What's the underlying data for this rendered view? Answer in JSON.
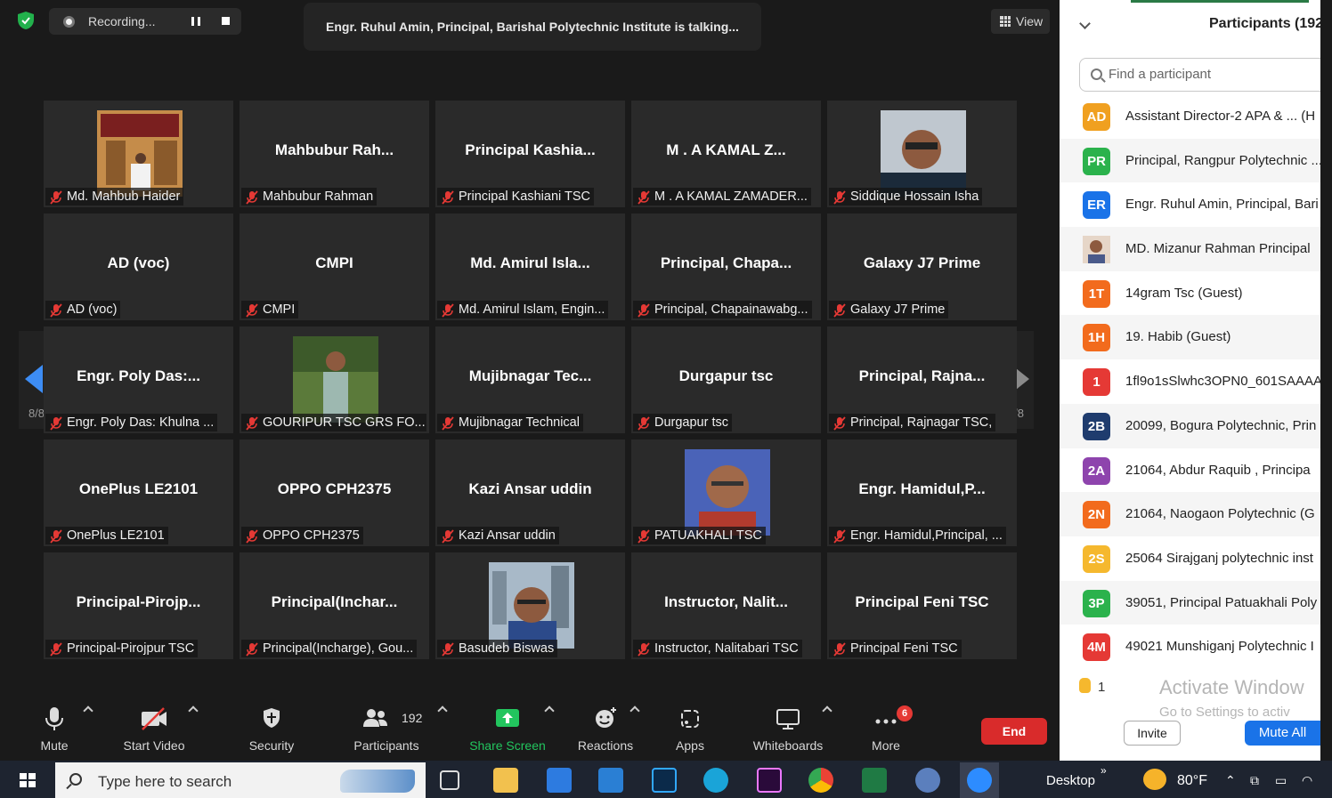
{
  "recording": {
    "label": "Recording..."
  },
  "talking_banner": "Engr. Ruhul Amin, Principal, Barishal Polytechnic Institute is talking...",
  "view_button": "View",
  "page_indicator": "8/8",
  "tiles": [
    {
      "title": "",
      "label": "Md. Mahbub Haider",
      "photo": "office-room"
    },
    {
      "title": "Mahbubur  Rah...",
      "label": "Mahbubur Rahman"
    },
    {
      "title": "Principal  Kashia...",
      "label": "Principal Kashiani TSC"
    },
    {
      "title": "M . A KAMAL Z...",
      "label": "M . A KAMAL ZAMADER..."
    },
    {
      "title": "",
      "label": "Siddique Hossain Isha",
      "photo": "man-glasses"
    },
    {
      "title": "AD (voc)",
      "label": "AD (voc)"
    },
    {
      "title": "CMPI",
      "label": "CMPI"
    },
    {
      "title": "Md. Amirul Isla...",
      "label": "Md. Amirul Islam, Engin..."
    },
    {
      "title": "Principal,  Chapa...",
      "label": "Principal, Chapainawabg..."
    },
    {
      "title": "Galaxy J7 Prime",
      "label": "Galaxy J7 Prime"
    },
    {
      "title": "Engr. Poly  Das:...",
      "label": "Engr. Poly  Das: Khulna ..."
    },
    {
      "title": "",
      "label": "GOURIPUR TSC GRS FO...",
      "photo": "man-outdoor"
    },
    {
      "title": "Mujibnagar  Tec...",
      "label": "Mujibnagar Technical"
    },
    {
      "title": "Durgapur tsc",
      "label": "Durgapur tsc"
    },
    {
      "title": "Principal,  Rajna...",
      "label": "Principal, Rajnagar TSC,"
    },
    {
      "title": "OnePlus LE2101",
      "label": "OnePlus LE2101"
    },
    {
      "title": "OPPO CPH2375",
      "label": "OPPO CPH2375"
    },
    {
      "title": "Kazi Ansar uddin",
      "label": "Kazi Ansar uddin"
    },
    {
      "title": "",
      "label": "PATUAKHALI TSC",
      "photo": "man-portrait"
    },
    {
      "title": "Engr.  Hamidul,P...",
      "label": "Engr. Hamidul,Principal, ..."
    },
    {
      "title": "Principal-Pirojp...",
      "label": "Principal-Pirojpur TSC"
    },
    {
      "title": "Principal(Inchar...",
      "label": "Principal(Incharge), Gou..."
    },
    {
      "title": "",
      "label": "Basudeb Biswas",
      "photo": "man-city"
    },
    {
      "title": "Instructor,  Nalit...",
      "label": "Instructor,  Nalitabari TSC"
    },
    {
      "title": "Principal Feni TSC",
      "label": "Principal Feni TSC"
    }
  ],
  "toolbar": {
    "mute": "Mute",
    "start_video": "Start Video",
    "security": "Security",
    "participants": "Participants",
    "participant_count": "192",
    "share_screen": "Share Screen",
    "reactions": "Reactions",
    "apps": "Apps",
    "whiteboards": "Whiteboards",
    "more": "More",
    "more_badge": "6",
    "end": "End"
  },
  "panel": {
    "title": "Participants (192",
    "search_placeholder": "Find a participant",
    "participants": [
      {
        "initials": "AD",
        "color": "#f0a020",
        "name": "Assistant Director-2 APA & ... (H"
      },
      {
        "initials": "PR",
        "color": "#2bb24c",
        "name": "Principal, Rangpur Polytechnic ..."
      },
      {
        "initials": "ER",
        "color": "#1a73e8",
        "name": "Engr. Ruhul Amin, Principal, Bari"
      },
      {
        "initials": "",
        "color": "#c9a890",
        "name": "MD. Mizanur Rahman Principal"
      },
      {
        "initials": "1T",
        "color": "#f26b1d",
        "name": "14gram Tsc (Guest)"
      },
      {
        "initials": "1H",
        "color": "#f26b1d",
        "name": "19. Habib (Guest)"
      },
      {
        "initials": "1",
        "color": "#e53935",
        "name": "1fl9o1sSlwhc3OPN0_601SAAAA"
      },
      {
        "initials": "2B",
        "color": "#1f3c6e",
        "name": "20099, Bogura Polytechnic, Prin"
      },
      {
        "initials": "2A",
        "color": "#8e44ad",
        "name": "21064,  Abdur Raquib , Principa"
      },
      {
        "initials": "2N",
        "color": "#f26b1d",
        "name": "21064, Naogaon Polytechnic (G"
      },
      {
        "initials": "2S",
        "color": "#f5b82e",
        "name": "25064 Sirajganj polytechnic inst"
      },
      {
        "initials": "3P",
        "color": "#2bb24c",
        "name": "39051, Principal Patuakhali Poly"
      },
      {
        "initials": "4M",
        "color": "#e53935",
        "name": "49021 Munshiganj Polytechnic I"
      }
    ],
    "raised_hands": "1",
    "watermark_title": "Activate Window",
    "watermark_sub": "Go to Settings to activ",
    "invite": "Invite",
    "mute_all": "Mute All"
  },
  "taskbar": {
    "search_placeholder": "Type here to search",
    "desktop": "Desktop",
    "temperature": "80°F"
  }
}
